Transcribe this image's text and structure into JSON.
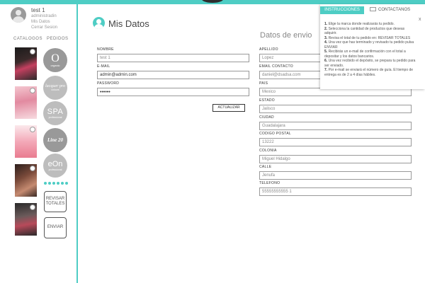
{
  "user": {
    "name": "test 1",
    "role": "administradin",
    "links": [
      "Mis Datos",
      "Cerrar Sesion"
    ]
  },
  "sidebar": {
    "catalogos_label": "CATALOGOS",
    "pedidos_label": "PEDIDOS",
    "brands": [
      {
        "title": "O",
        "sub": "organic"
      },
      {
        "title": "lacquer pro",
        "sub": "colours"
      },
      {
        "title": "SPA",
        "sub": "professional"
      },
      {
        "title": "Line 20",
        "sub": ""
      },
      {
        "title": "eOn",
        "sub": "professional"
      }
    ],
    "revisar_label": "REVISAR TOTALES",
    "enviar_label": "ENVIAR"
  },
  "main": {
    "title": "Mis Datos",
    "envio_title": "Datos de envio",
    "account": {
      "nombre_label": "NOMBRE",
      "nombre_value": "test 1",
      "email_label": "E-MAIL",
      "email_value": "admin@admin.com",
      "password_label": "PASSWORD",
      "password_value": "••••••",
      "actualizar_label": "ACTUALIZAR"
    },
    "envio": {
      "apellido_label": "APELLIDO",
      "apellido_value": "Lopez",
      "email_contacto_label": "EMAIL CONTACTO",
      "email_contacto_value": "daniel@dsadsa.com",
      "pais_label": "PAIS",
      "pais_value": "Mexico",
      "estado_label": "ESTADO",
      "estado_value": "Jalisco",
      "ciudad_label": "CIUDAD",
      "ciudad_value": "Guadalajara",
      "cp_label": "CODIGO POSTAL",
      "cp_value": "13222",
      "colonia_label": "COLONIA",
      "colonia_value": "Miguel Hidalgo",
      "calle_label": "CALLE",
      "calle_value": "Jenufa",
      "telefono_label": "TELEFONO",
      "telefono_value": "55555555555 1"
    }
  },
  "panel": {
    "tab_instrucciones": "INSTRUCCIONES",
    "tab_contactanos": "CONTACTANOS",
    "close": "x",
    "steps": [
      {
        "n": "1.",
        "t": "Elige la marca donde realizarás tu pedido."
      },
      {
        "n": "2.",
        "t": "Selecciona la cantidad de productos que deseas adquirir."
      },
      {
        "n": "3.",
        "t": "Revisa el total de tu pedido en: REVISAR TOTALES"
      },
      {
        "n": "4.",
        "t": "Una vez que has terminado y revisado tu pedido pulsa ENVIAR"
      },
      {
        "n": "5.",
        "t": "Recibirás un e-mail de confirmación con el total a depositar y los datos bancarios."
      },
      {
        "n": "6.",
        "t": "Una vez recibido el depósito, se prepara tu pedido para ser enviado."
      },
      {
        "n": "7.",
        "t": "Por e-mail se enviará el número de guía. El tiempo de entrega es de 2 a 4 días hábiles."
      }
    ]
  },
  "colors": {
    "accent": "#4ecdc4",
    "border": "#999999"
  }
}
